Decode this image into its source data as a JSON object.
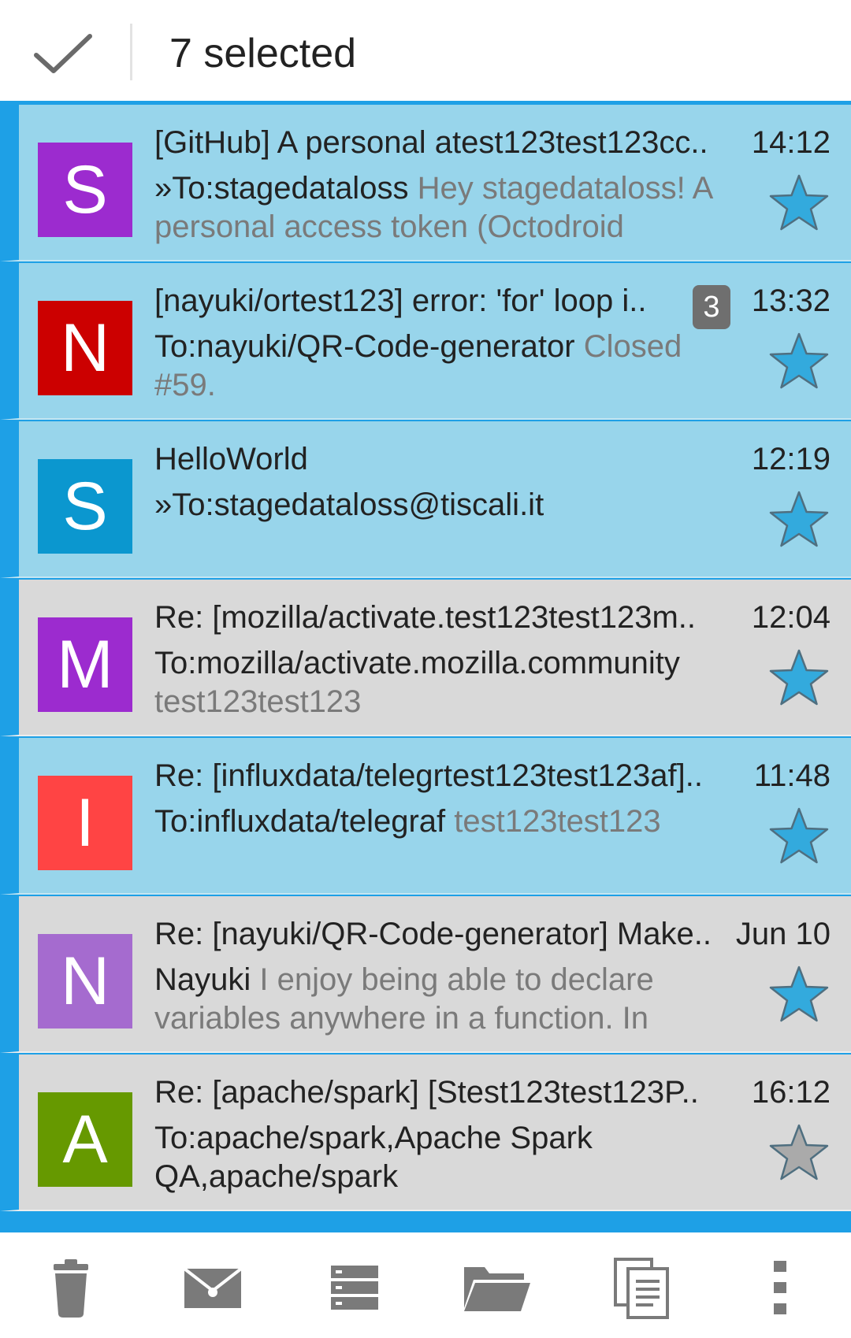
{
  "header": {
    "title": "7 selected"
  },
  "messages": [
    {
      "avatar_letter": "S",
      "avatar_color": "#9c2bcf",
      "subject": "[GitHub] A personal atest123test123cc..",
      "time": "14:12",
      "sender": "»To:stagedataloss",
      "preview": " Hey stagedataloss! A personal access token (Octodroid",
      "badge": "",
      "starred": true,
      "selected": true
    },
    {
      "avatar_letter": "N",
      "avatar_color": "#cc0000",
      "subject": "[nayuki/ortest123] error: 'for' loop i..",
      "time": "13:32",
      "sender": "To:nayuki/QR-Code-generator",
      "preview": " Closed #59.",
      "badge": "3",
      "starred": true,
      "selected": true
    },
    {
      "avatar_letter": "S",
      "avatar_color": "#0b97cf",
      "subject": "HelloWorld",
      "time": "12:19",
      "sender": "»To:stagedataloss@tiscali.it",
      "preview": "",
      "badge": "",
      "starred": true,
      "selected": true
    },
    {
      "avatar_letter": "M",
      "avatar_color": "#9c2bcf",
      "subject": "Re: [mozilla/activate.test123test123m..",
      "time": "12:04",
      "sender": "To:mozilla/activate.mozilla.community",
      "preview": " test123test123",
      "badge": "",
      "starred": true,
      "selected": false
    },
    {
      "avatar_letter": "I",
      "avatar_color": "#ff4444",
      "subject": "Re: [influxdata/telegrtest123test123af]..",
      "time": "11:48",
      "sender": "To:influxdata/telegraf",
      "preview": " test123test123",
      "badge": "",
      "starred": true,
      "selected": true
    },
    {
      "avatar_letter": "N",
      "avatar_color": "#a56bcf",
      "subject": "Re: [nayuki/QR-Code-generator] Make..",
      "time": "Jun 10",
      "sender": "Nayuki",
      "preview": " I enjoy being able to declare variables anywhere in a function. In",
      "badge": "",
      "starred": true,
      "selected": false
    },
    {
      "avatar_letter": "A",
      "avatar_color": "#669900",
      "subject": "Re: [apache/spark] [Stest123test123P..",
      "time": "16:12",
      "sender": "To:apache/spark,Apache Spark QA,apache/spark",
      "preview": "",
      "badge": "",
      "starred": false,
      "selected": false
    }
  ],
  "bottom_bar": {
    "icons": [
      "delete-icon",
      "mark-read-icon",
      "archive-icon",
      "move-to-folder-icon",
      "copy-icon",
      "more-overflow-icon"
    ]
  },
  "colors": {
    "accent": "#1ea0e6",
    "selected_row": "#98d5eb",
    "unselected_row": "#d9d9d9",
    "star_on": "#33aadd",
    "star_off": "#aaaaaa"
  }
}
